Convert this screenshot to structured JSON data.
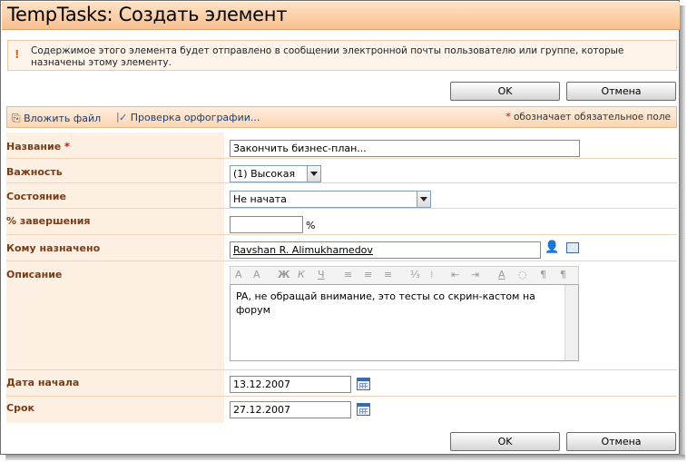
{
  "page": {
    "title": "TempTasks: Создать элемент"
  },
  "notice": {
    "text": "Содержимое этого элемента будет отправлено в сообщении электронной почты пользователю или группе, которые назначены этому элементу."
  },
  "buttons": {
    "ok": "OK",
    "cancel": "Отмена"
  },
  "toolbar": {
    "attach": "Вложить файл",
    "separator": "|",
    "spellcheck": "Проверка орфографии...",
    "required_star": "*",
    "required_note": " обозначает обязательное поле"
  },
  "form": {
    "title": {
      "label": "Название",
      "star": "*",
      "value": "Закончить бизнес-план..."
    },
    "priority": {
      "label": "Важность",
      "value": "(1) Высокая"
    },
    "status": {
      "label": "Состояние",
      "value": "Не начата"
    },
    "percent": {
      "label": "% завершения",
      "value": "",
      "suffix": "%"
    },
    "assigned": {
      "label": "Кому назначено",
      "value": "Ravshan R. Alimukhamedov"
    },
    "description": {
      "label": "Описание",
      "value": "PA, не обращай внимание, это тесты со скрин-кастом на форум"
    },
    "start_date": {
      "label": "Дата начала",
      "value": "13.12.2007"
    },
    "due_date": {
      "label": "Срок",
      "value": "27.12.2007"
    }
  },
  "rte_toolbar": [
    "A",
    "A",
    "Ж",
    "К",
    "Ч",
    "≡",
    "≡",
    "≡",
    "⅓",
    "⁝",
    "⇤",
    "⇥",
    "A",
    "◌",
    "¶",
    "¶"
  ],
  "colors": {
    "title_bar": "#f9c08f",
    "label_text": "#7a3b16",
    "required": "#e00000",
    "label_bg": "#fdf0e2"
  }
}
